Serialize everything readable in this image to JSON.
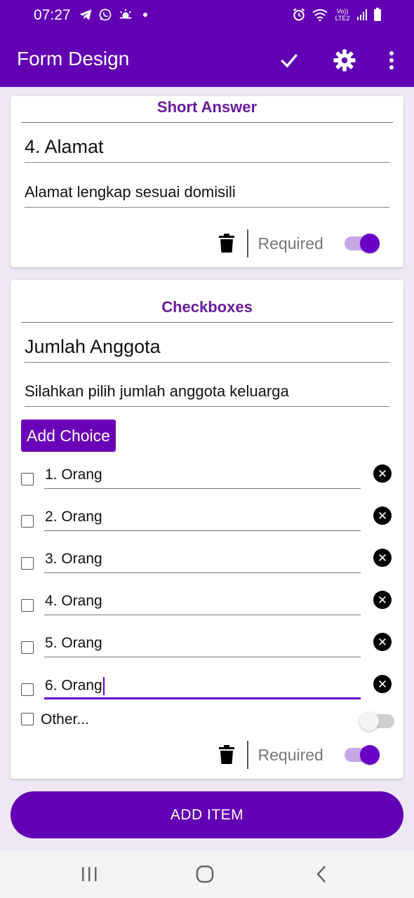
{
  "status_bar": {
    "time": "07:27",
    "left_icons": [
      "telegram-icon",
      "whatsapp-icon",
      "weather-icon",
      "dot-icon"
    ],
    "right_icons": [
      "alarm-icon",
      "wifi-icon",
      "volte-lte2-icon",
      "signal-icon",
      "battery-icon"
    ],
    "network_label": "Vo)) LTE2"
  },
  "app_bar": {
    "title": "Form Design",
    "actions": [
      "check-icon",
      "settings-icon",
      "more-vert-icon"
    ]
  },
  "cards": [
    {
      "type_label": "Short Answer",
      "title": "4. Alamat",
      "description": "Alamat lengkap sesuai domisili",
      "required_label": "Required",
      "required": true
    },
    {
      "type_label": "Checkboxes",
      "title": "Jumlah Anggota",
      "description": "Silahkan pilih jumlah anggota keluarga",
      "add_choice_label": "Add Choice",
      "choices": [
        "1. Orang",
        "2. Orang",
        "3. Orang",
        "4. Orang",
        "5. Orang",
        "6. Orang"
      ],
      "active_choice_index": 5,
      "other_label": "Other...",
      "other_enabled": false,
      "required_label": "Required",
      "required": true
    }
  ],
  "add_item_label": "ADD ITEM",
  "colors": {
    "primary": "#6200b3",
    "accent": "#6a00c7",
    "type_label": "#6a1b9a",
    "background": "#ede7f6"
  }
}
